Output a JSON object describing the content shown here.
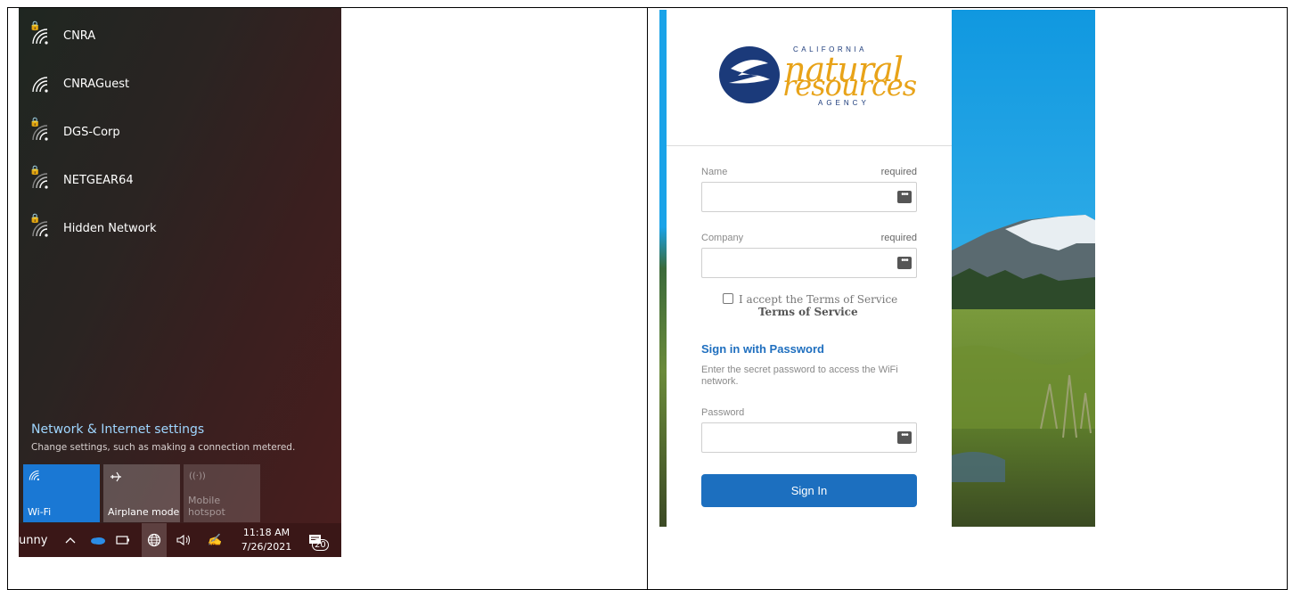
{
  "windows_flyout": {
    "networks": [
      {
        "name": "CNRA",
        "secured": true
      },
      {
        "name": "CNRAGuest",
        "secured": false
      },
      {
        "name": "DGS-Corp",
        "secured": true
      },
      {
        "name": "NETGEAR64",
        "secured": true
      },
      {
        "name": "Hidden Network",
        "secured": true
      }
    ],
    "settings_title": "Network & Internet settings",
    "settings_subtitle": "Change settings, such as making a connection metered.",
    "quick_actions": {
      "wifi": "Wi-Fi",
      "airplane": "Airplane mode",
      "hotspot_line1": "Mobile",
      "hotspot_line2": "hotspot"
    },
    "taskbar": {
      "weather_text": "unny",
      "time": "11:18 AM",
      "date": "7/26/2021",
      "notification_count": "20"
    }
  },
  "portal": {
    "logo": {
      "line_top": "CALIFORNIA",
      "line_natural": "natural",
      "line_resources": "resources",
      "line_bottom": "AGENCY",
      "brand_blue": "#1b3a7a",
      "brand_gold": "#e8a319"
    },
    "name_label": "Name",
    "name_required": "required",
    "name_value": "",
    "company_label": "Company",
    "company_required": "required",
    "company_value": "",
    "tos_text": "I accept the Terms of Service",
    "tos_link": "Terms of Service",
    "signin_heading": "Sign in with Password",
    "signin_desc": "Enter the secret password to access the WiFi network.",
    "password_label": "Password",
    "password_value": "",
    "signin_button": "Sign In",
    "accent_color": "#1c6fbf"
  }
}
